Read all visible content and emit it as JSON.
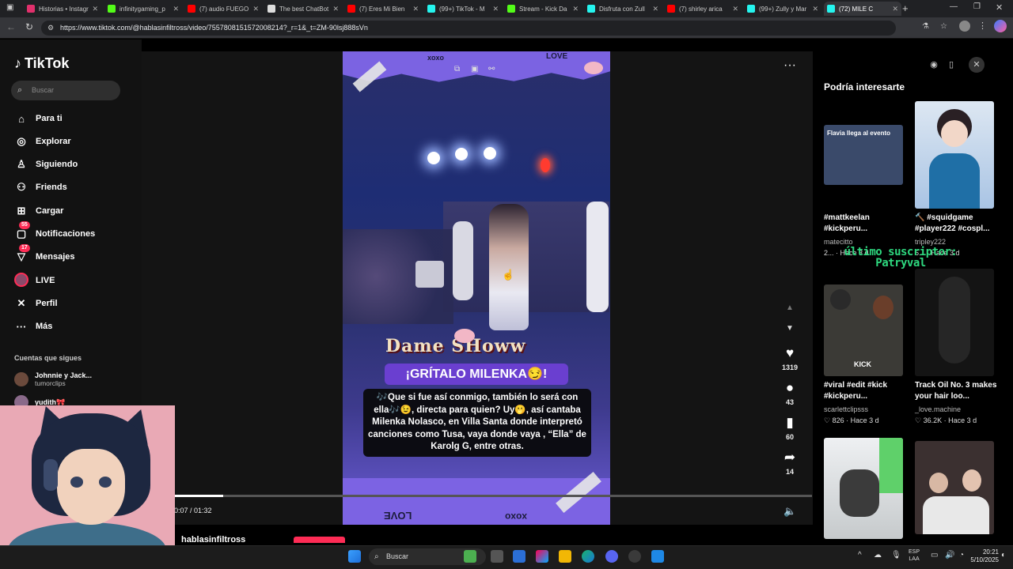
{
  "browser": {
    "tabs": [
      {
        "label": "Historias • Instagr",
        "color": "#e1306c"
      },
      {
        "label": "infinitygaming_p",
        "color": "#53fc18"
      },
      {
        "label": "(7) audio FUEGO",
        "color": "#ff0000"
      },
      {
        "label": "The best ChatBot",
        "color": "#dddddd"
      },
      {
        "label": "(7) Eres Mi Bien",
        "color": "#ff0000"
      },
      {
        "label": "(99+) TikTok - M",
        "color": "#25f4ee"
      },
      {
        "label": "Stream - Kick Da",
        "color": "#53fc18"
      },
      {
        "label": "Disfruta con Zull",
        "color": "#25f4ee"
      },
      {
        "label": "(7) shirley arica",
        "color": "#ff0000"
      },
      {
        "label": "(99+) Zully y Mar",
        "color": "#25f4ee"
      },
      {
        "label": "(72) MILE C",
        "color": "#25f4ee"
      }
    ],
    "url": "https://www.tiktok.com/@hablasinfiltross/video/7557808151572008214?_r=1&_t=ZM-90lsj888sVn"
  },
  "sidebar": {
    "logo": "TikTok",
    "search_placeholder": "Buscar",
    "items": [
      {
        "label": "Para ti",
        "icon": "home-icon"
      },
      {
        "label": "Explorar",
        "icon": "compass-icon"
      },
      {
        "label": "Siguiendo",
        "icon": "following-icon"
      },
      {
        "label": "Friends",
        "icon": "friends-icon"
      },
      {
        "label": "Cargar",
        "icon": "upload-icon"
      },
      {
        "label": "Notificaciones",
        "icon": "bell-icon",
        "badge": "55"
      },
      {
        "label": "Mensajes",
        "icon": "message-icon",
        "badge": "17"
      },
      {
        "label": "LIVE",
        "icon": "live-icon"
      },
      {
        "label": "Perfil",
        "icon": "profile-icon"
      },
      {
        "label": "Más",
        "icon": "more-icon"
      }
    ],
    "following_title": "Cuentas que sigues",
    "following": [
      {
        "name": "Johnnie y Jack...",
        "handle": "tumorclips"
      },
      {
        "name": "yudith🎀",
        "handle": ""
      }
    ]
  },
  "video": {
    "dame_text": "Dame SHoww",
    "headline": "¡GRÍTALO MILENKA😏!",
    "caption": "🎶Que si fue así conmigo, también lo será con ella🎶😉, directa para quien? Uy🫢, así cantaba Milenka Nolasco, en Villa Santa donde interpretó canciones como Tusa, vaya donde vaya , “Ella” de Karolg G, entre otras.",
    "top_words": [
      "xoxo",
      "LOVE"
    ],
    "bottom_words": [
      "LOVE",
      "xoxo"
    ],
    "time": "0:07 / 01:32",
    "progress_fraction": 0.076,
    "author": "hablasinfiltross"
  },
  "actions": {
    "likes": "1319",
    "comments": "43",
    "saves": "60",
    "shares": "14"
  },
  "right_panel": {
    "title": "Podría interesarte",
    "overlay_line1": "último suscriptor:",
    "overlay_line2": "Patryval",
    "cards": [
      {
        "title": "#mattkeelan #kickperu...",
        "user": "matecitto",
        "meta": "2... · Hace 3 d",
        "thumb_text": "Flavia llega al evento",
        "thumb_color": "#3a4a6a"
      },
      {
        "title": "🔨 #squidgame #player222 #cospl...",
        "user": "tripley222",
        "meta": "5... · Hace 3 d",
        "thumb_text": "",
        "thumb_color": "#c7d5e8"
      },
      {
        "title": "#viral #edit #kick #kickperu...",
        "user": "scarlettclipsss",
        "meta": "826 · Hace 3 d",
        "thumb_text": "KICK",
        "thumb_color": "#3b3a36"
      },
      {
        "title": "Track Oil No. 3 makes your hair loo...",
        "user": "_love.machine",
        "meta": "36.2K · Hace 3 d",
        "thumb_text": "",
        "thumb_color": "#141414"
      },
      {
        "title": "",
        "user": "",
        "meta": "",
        "thumb_text": "",
        "thumb_color": "#dfe3e6"
      },
      {
        "title": "",
        "user": "",
        "meta": "",
        "thumb_text": "",
        "thumb_color": "#3b3030"
      }
    ]
  },
  "taskbar": {
    "search_placeholder": "Buscar",
    "lang_line1": "ESP",
    "lang_line2": "LAA",
    "time": "20:21",
    "date": "5/10/2025"
  }
}
